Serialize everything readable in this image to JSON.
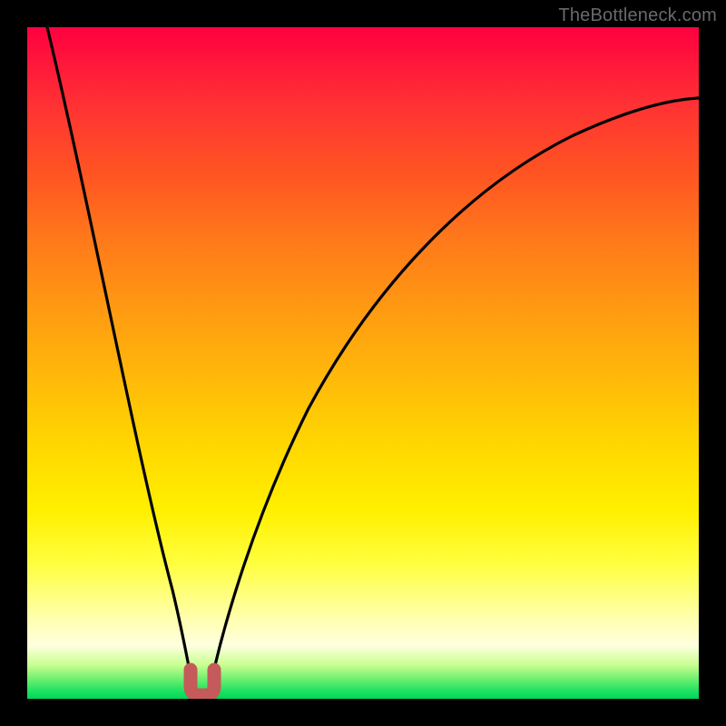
{
  "watermark": "TheBottleneck.com",
  "colors": {
    "frame": "#000000",
    "curve": "#000000",
    "marker": "#c45a5a",
    "gradient_top": "#ff0040",
    "gradient_bottom": "#00d858"
  },
  "chart_data": {
    "type": "line",
    "title": "",
    "xlabel": "",
    "ylabel": "",
    "xlim": [
      0,
      100
    ],
    "ylim": [
      0,
      100
    ],
    "grid": false,
    "series": [
      {
        "name": "left-branch",
        "x": [
          3,
          5,
          7,
          9,
          11,
          13,
          15,
          17,
          19,
          21,
          23,
          24.5
        ],
        "values": [
          100,
          92,
          83,
          74,
          65,
          56,
          47,
          38,
          29,
          20,
          10,
          2
        ]
      },
      {
        "name": "right-branch",
        "x": [
          27,
          30,
          33,
          37,
          41,
          46,
          52,
          58,
          65,
          73,
          82,
          91,
          100
        ],
        "values": [
          2,
          10,
          20,
          31,
          41,
          50,
          58,
          65,
          71,
          77,
          82,
          86,
          89
        ]
      }
    ],
    "annotations": [
      {
        "name": "optimum-marker-left",
        "x": 24.2,
        "y": 2,
        "shape": "round-stroke"
      },
      {
        "name": "optimum-marker-right",
        "x": 27.2,
        "y": 2,
        "shape": "round-stroke"
      }
    ]
  }
}
